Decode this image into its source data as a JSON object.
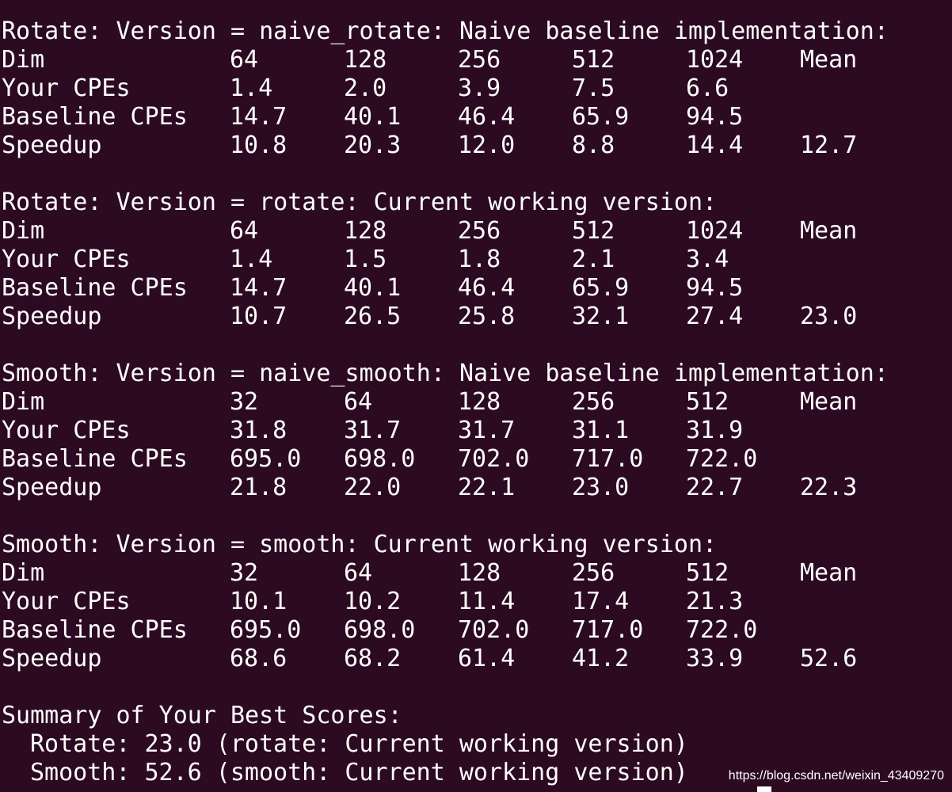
{
  "blocks": [
    {
      "header": "Rotate: Version = naive_rotate: Naive baseline implementation:",
      "rows": [
        [
          "Dim",
          "64",
          "128",
          "256",
          "512",
          "1024",
          "Mean"
        ],
        [
          "Your CPEs",
          "1.4",
          "2.0",
          "3.9",
          "7.5",
          "6.6",
          ""
        ],
        [
          "Baseline CPEs",
          "14.7",
          "40.1",
          "46.4",
          "65.9",
          "94.5",
          ""
        ],
        [
          "Speedup",
          "10.8",
          "20.3",
          "12.0",
          "8.8",
          "14.4",
          "12.7"
        ]
      ]
    },
    {
      "header": "Rotate: Version = rotate: Current working version:",
      "rows": [
        [
          "Dim",
          "64",
          "128",
          "256",
          "512",
          "1024",
          "Mean"
        ],
        [
          "Your CPEs",
          "1.4",
          "1.5",
          "1.8",
          "2.1",
          "3.4",
          ""
        ],
        [
          "Baseline CPEs",
          "14.7",
          "40.1",
          "46.4",
          "65.9",
          "94.5",
          ""
        ],
        [
          "Speedup",
          "10.7",
          "26.5",
          "25.8",
          "32.1",
          "27.4",
          "23.0"
        ]
      ]
    },
    {
      "header": "Smooth: Version = naive_smooth: Naive baseline implementation:",
      "rows": [
        [
          "Dim",
          "32",
          "64",
          "128",
          "256",
          "512",
          "Mean"
        ],
        [
          "Your CPEs",
          "31.8",
          "31.7",
          "31.7",
          "31.1",
          "31.9",
          ""
        ],
        [
          "Baseline CPEs",
          "695.0",
          "698.0",
          "702.0",
          "717.0",
          "722.0",
          ""
        ],
        [
          "Speedup",
          "21.8",
          "22.0",
          "22.1",
          "23.0",
          "22.7",
          "22.3"
        ]
      ]
    },
    {
      "header": "Smooth: Version = smooth: Current working version:",
      "rows": [
        [
          "Dim",
          "32",
          "64",
          "128",
          "256",
          "512",
          "Mean"
        ],
        [
          "Your CPEs",
          "10.1",
          "10.2",
          "11.4",
          "17.4",
          "21.3",
          ""
        ],
        [
          "Baseline CPEs",
          "695.0",
          "698.0",
          "702.0",
          "717.0",
          "722.0",
          ""
        ],
        [
          "Speedup",
          "68.6",
          "68.2",
          "61.4",
          "41.2",
          "33.9",
          "52.6"
        ]
      ]
    }
  ],
  "summary": {
    "title": "Summary of Your Best Scores:",
    "rotate": "Rotate: 23.0 (rotate: Current working version)",
    "smooth": "Smooth: 52.6 (smooth: Current working version)"
  },
  "watermark": "https://blog.csdn.net/weixin_43409270",
  "colors": {
    "background": "#2c0a22",
    "text": "#ffffff",
    "prompt": "#d8d84a"
  }
}
